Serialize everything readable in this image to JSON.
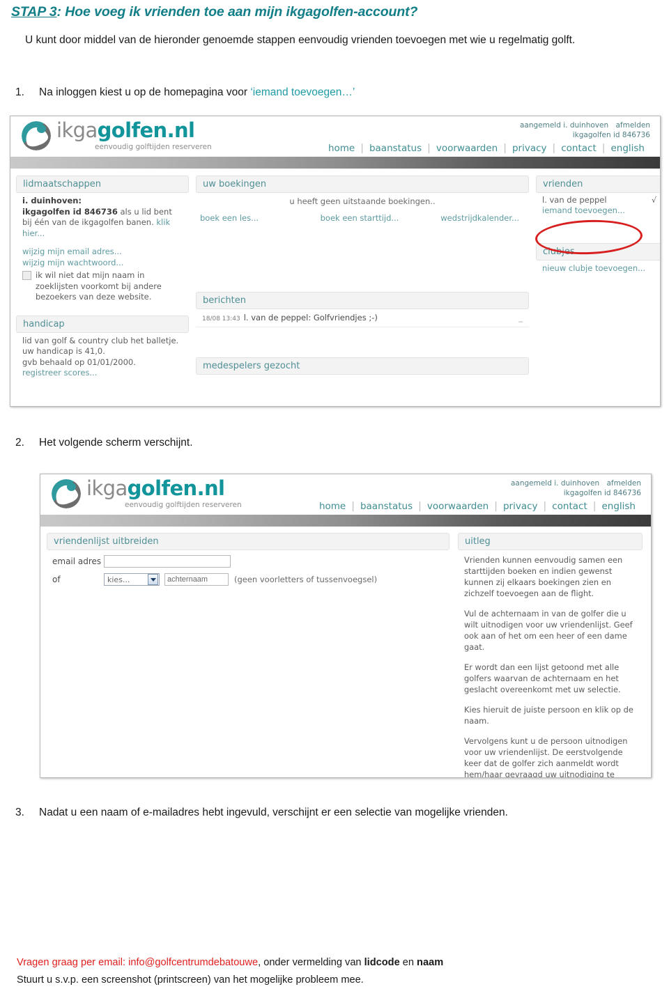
{
  "document": {
    "title_prefix": "STAP 3",
    "title_rest": ": Hoe voeg ik vrienden toe aan mijn ikgagolfen-account?",
    "intro": "U kunt door middel van de hieronder genoemde stappen eenvoudig vrienden toevoegen met wie u regelmatig golft.",
    "steps": [
      {
        "number": "1.",
        "text_before": "Na inloggen kiest u op de homepagina voor ",
        "highlight": "‘iemand toevoegen…’",
        "text_after": ""
      },
      {
        "number": "2.",
        "text_before": "Het volgende scherm verschijnt.",
        "highlight": "",
        "text_after": ""
      },
      {
        "number": "3.",
        "text_before": "Nadat u een naam of e-mailadres hebt ingevuld, verschijnt er een selectie van mogelijke vrienden.",
        "highlight": "",
        "text_after": ""
      }
    ],
    "footer": {
      "line1_red": "Vragen graag per email: info@golfcentrumdebatouwe",
      "line1_rest_a": ", onder vermelding van ",
      "line1_bold_a": "lidcode",
      "line1_rest_b": " en ",
      "line1_bold_b": "naam",
      "line2": "Stuurt u s.v.p. een screenshot (printscreen) van het mogelijke probleem mee."
    },
    "colors": {
      "heading_teal": "#127e87",
      "link_teal": "#1f9aa3",
      "footer_red": "#e02020",
      "annotation_red": "#d81f1f"
    }
  },
  "site_header": {
    "logo_primary": "ikga",
    "logo_secondary": "golfen.nl",
    "tagline": "eenvoudig golftijden reserveren",
    "account_status": "aangemeld i. duinhoven",
    "logout_label": "afmelden",
    "member_id": "ikgagolfen id 846736",
    "nav": [
      "home",
      "baanstatus",
      "voorwaarden",
      "privacy",
      "contact",
      "english"
    ]
  },
  "screenshot1": {
    "memberships": {
      "panel_title": "lidmaatschappen",
      "user_name": "i. duinhoven:",
      "id_bold": "ikgagolfen id 846736",
      "id_rest": " als u lid bent bij één van de ikgagolfen banen. ",
      "id_link": "klik hier...",
      "link_email": "wijzig mijn email adres...",
      "link_password": "wijzig mijn wachtwoord...",
      "checkbox_label": "ik wil niet dat mijn naam in zoeklijsten voorkomt bij andere bezoekers van deze website.",
      "checkbox_checked": false
    },
    "handicap": {
      "panel_title": "handicap",
      "line1": "lid van golf & country club het balletje.",
      "line2": "uw handicap is 41,0.",
      "line3": "gvb behaald op 01/01/2000.",
      "link": "registreer scores..."
    },
    "bookings": {
      "panel_title": "uw boekingen",
      "empty_text": "u heeft geen uitstaande boekingen..",
      "links": [
        "boek een les...",
        "boek een starttijd...",
        "wedstrijdkalender..."
      ]
    },
    "messages": {
      "panel_title": "berichten",
      "rows": [
        {
          "timestamp": "18/08 13:43",
          "text": "l. van de peppel: Golfvriendjes ;-)",
          "right_mark": "_"
        }
      ]
    },
    "coplayers": {
      "panel_title": "medespelers gezocht"
    },
    "friends": {
      "panel_title": "vrienden",
      "entries": [
        {
          "name": "l. van de peppel",
          "tick": "√",
          "extra": "."
        }
      ],
      "add_link": "iemand toevoegen...",
      "annotation": "red-ellipse-around-iemand-toevoegen"
    },
    "clubs": {
      "panel_title": "clubjes",
      "add_link": "nieuw clubje toevoegen..."
    }
  },
  "screenshot2": {
    "form": {
      "panel_title": "vriendenlijst uitbreiden",
      "email_label": "email adres",
      "email_value": "",
      "email_placeholder": "",
      "or_label": "of",
      "select_value": "kies...",
      "lastname_value": "achternaam",
      "hint": "(geen voorletters of tussenvoegsel)"
    },
    "explanation": {
      "panel_title": "uitleg",
      "paragraphs": [
        "Vrienden kunnen eenvoudig samen een starttijden boeken en indien gewenst kunnen zij elkaars boekingen zien en zichzelf toevoegen aan de flight.",
        "Vul de achternaam in van de golfer die u wilt uitnodigen voor uw vriendenlijst. Geef ook aan of het om een heer of een dame gaat.",
        "Er wordt dan een lijst getoond met alle golfers waarvan de achternaam en het geslacht overeenkomt met uw selectie.",
        "Kies hieruit de juiste persoon en klik op de naam.",
        "Vervolgens kunt u de persoon uitnodigen voor uw vriendenlijst. De eerstvolgende keer dat de golfer zich aanmeldt wordt hem/haar gevraagd uw uitnodiging te accepteren. Hierna verschijnt de naam vanzelf in uw vriendenlijst."
      ]
    }
  }
}
